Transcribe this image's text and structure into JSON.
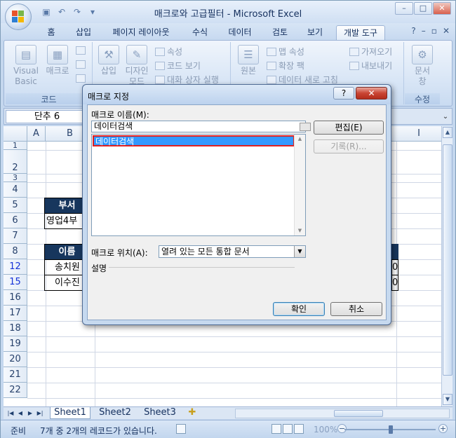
{
  "window": {
    "title": "매크로와 고급필터 - Microsoft Excel",
    "controls": {
      "minimize": "–",
      "restore": "□",
      "close": "✕"
    }
  },
  "ribbon": {
    "tabs": [
      "홈",
      "삽입",
      "페이지 레이아웃",
      "수식",
      "데이터",
      "검토",
      "보기",
      "개발 도구"
    ],
    "active_tab": "개발 도구",
    "groups": {
      "code": {
        "label": "코드",
        "visual_basic": "Visual\nBasic",
        "macro": "매크로"
      },
      "controls": {
        "insert": "삽입",
        "design_mode": "디자인\n모드",
        "properties": "속성",
        "view_code": "코드 보기",
        "run_dialog": "대화 상자 실행"
      },
      "xml": {
        "source": "원본",
        "map_properties": "맵 속성",
        "expansion_packs": "확장 팩",
        "refresh_data": "데이터 새로 고침",
        "import": "가져오기",
        "export": "내보내기"
      },
      "modify": {
        "label": "수정",
        "document_panel": "문서\n창"
      }
    }
  },
  "formula_bar": {
    "name_box": "단추 6"
  },
  "sheet": {
    "columns": [
      "A",
      "B",
      "I"
    ],
    "rows": [
      "1",
      "2",
      "3",
      "4",
      "5",
      "6",
      "7",
      "8",
      "12",
      "15",
      "16",
      "17",
      "18",
      "19",
      "20",
      "21",
      "22"
    ],
    "cells": {
      "b5": "부서",
      "b6": "영업4부",
      "b8": "이름",
      "b12": "송치원",
      "b15": "이수진",
      "i12": "0",
      "i15": "0"
    }
  },
  "sheet_tabs": [
    "Sheet1",
    "Sheet2",
    "Sheet3"
  ],
  "active_sheet": "Sheet1",
  "status_bar": {
    "mode": "준비",
    "message": "7개 중 2개의 레코드가 있습니다.",
    "zoom": "100%"
  },
  "dialog": {
    "title": "매크로 지정",
    "help": "?",
    "close": "✕",
    "macro_name_label": "매크로 이름(M):",
    "macro_name_value": "데이터검색",
    "macro_list": [
      "데이터검색"
    ],
    "selected_macro": "데이터검색",
    "edit_button": "편집(E)",
    "record_button": "기록(R)...",
    "location_label": "매크로 위치(A):",
    "location_value": "열려 있는 모든 통합 문서",
    "description_label": "설명",
    "ok_button": "확인",
    "cancel_button": "취소"
  },
  "colors": {
    "header_fill": "#17365d",
    "selection": "#3399ff",
    "highlight_border": "#e02020",
    "close_red": "#c94433"
  }
}
